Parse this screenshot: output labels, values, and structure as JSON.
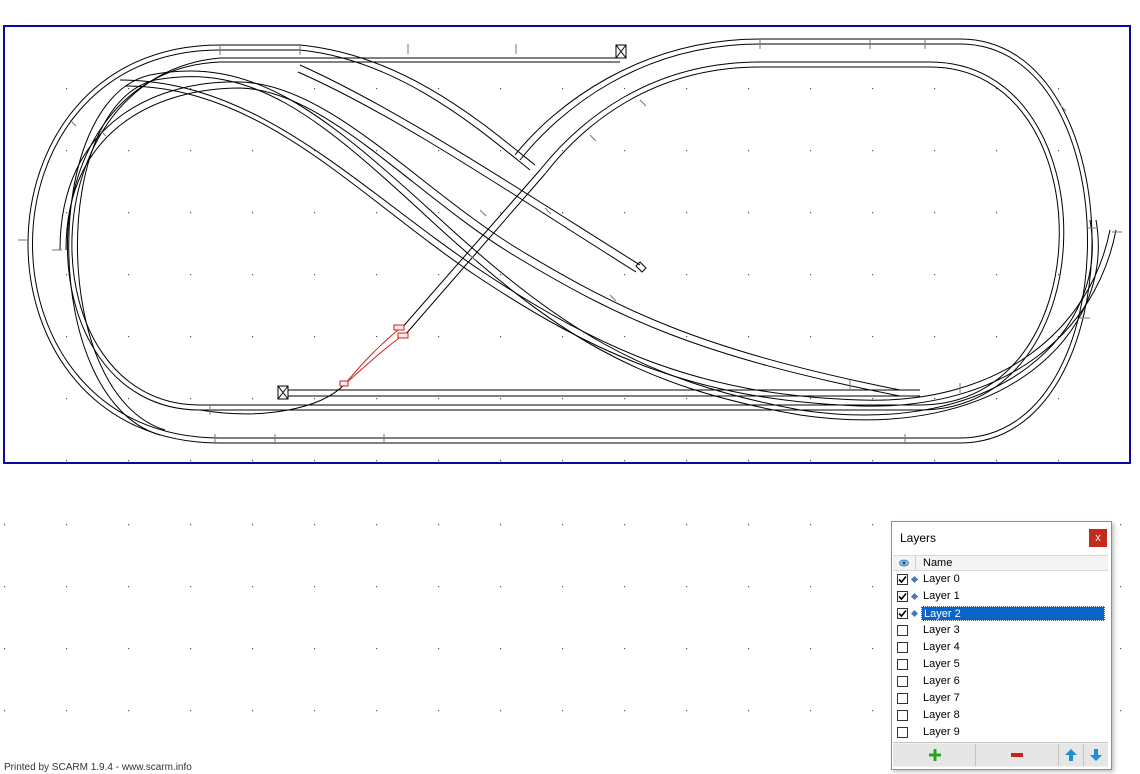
{
  "footer": {
    "text": "Printed by SCARM 1.9.4 - www.scarm.info"
  },
  "layers_panel": {
    "title": "Layers",
    "close_label": "x",
    "column_header": "Name",
    "layers": [
      {
        "name": "Layer 0",
        "checked": true,
        "selected": false
      },
      {
        "name": "Layer 1",
        "checked": true,
        "selected": false
      },
      {
        "name": "Layer 2",
        "checked": true,
        "selected": true
      },
      {
        "name": "Layer 3",
        "checked": false,
        "selected": false
      },
      {
        "name": "Layer 4",
        "checked": false,
        "selected": false
      },
      {
        "name": "Layer 5",
        "checked": false,
        "selected": false
      },
      {
        "name": "Layer 6",
        "checked": false,
        "selected": false
      },
      {
        "name": "Layer 7",
        "checked": false,
        "selected": false
      },
      {
        "name": "Layer 8",
        "checked": false,
        "selected": false
      },
      {
        "name": "Layer 9",
        "checked": false,
        "selected": false
      }
    ],
    "toolbar": {
      "add_icon": "plus-icon",
      "remove_icon": "minus-icon",
      "up_icon": "arrow-up-icon",
      "down_icon": "arrow-down-icon"
    }
  },
  "colors": {
    "board_border": "#0a0aa0",
    "track": "#000000",
    "selected_track": "#cc2222",
    "selection": "#0a64c8",
    "add": "#1fa81f",
    "remove": "#cc2020",
    "arrow": "#1a8fd6"
  }
}
